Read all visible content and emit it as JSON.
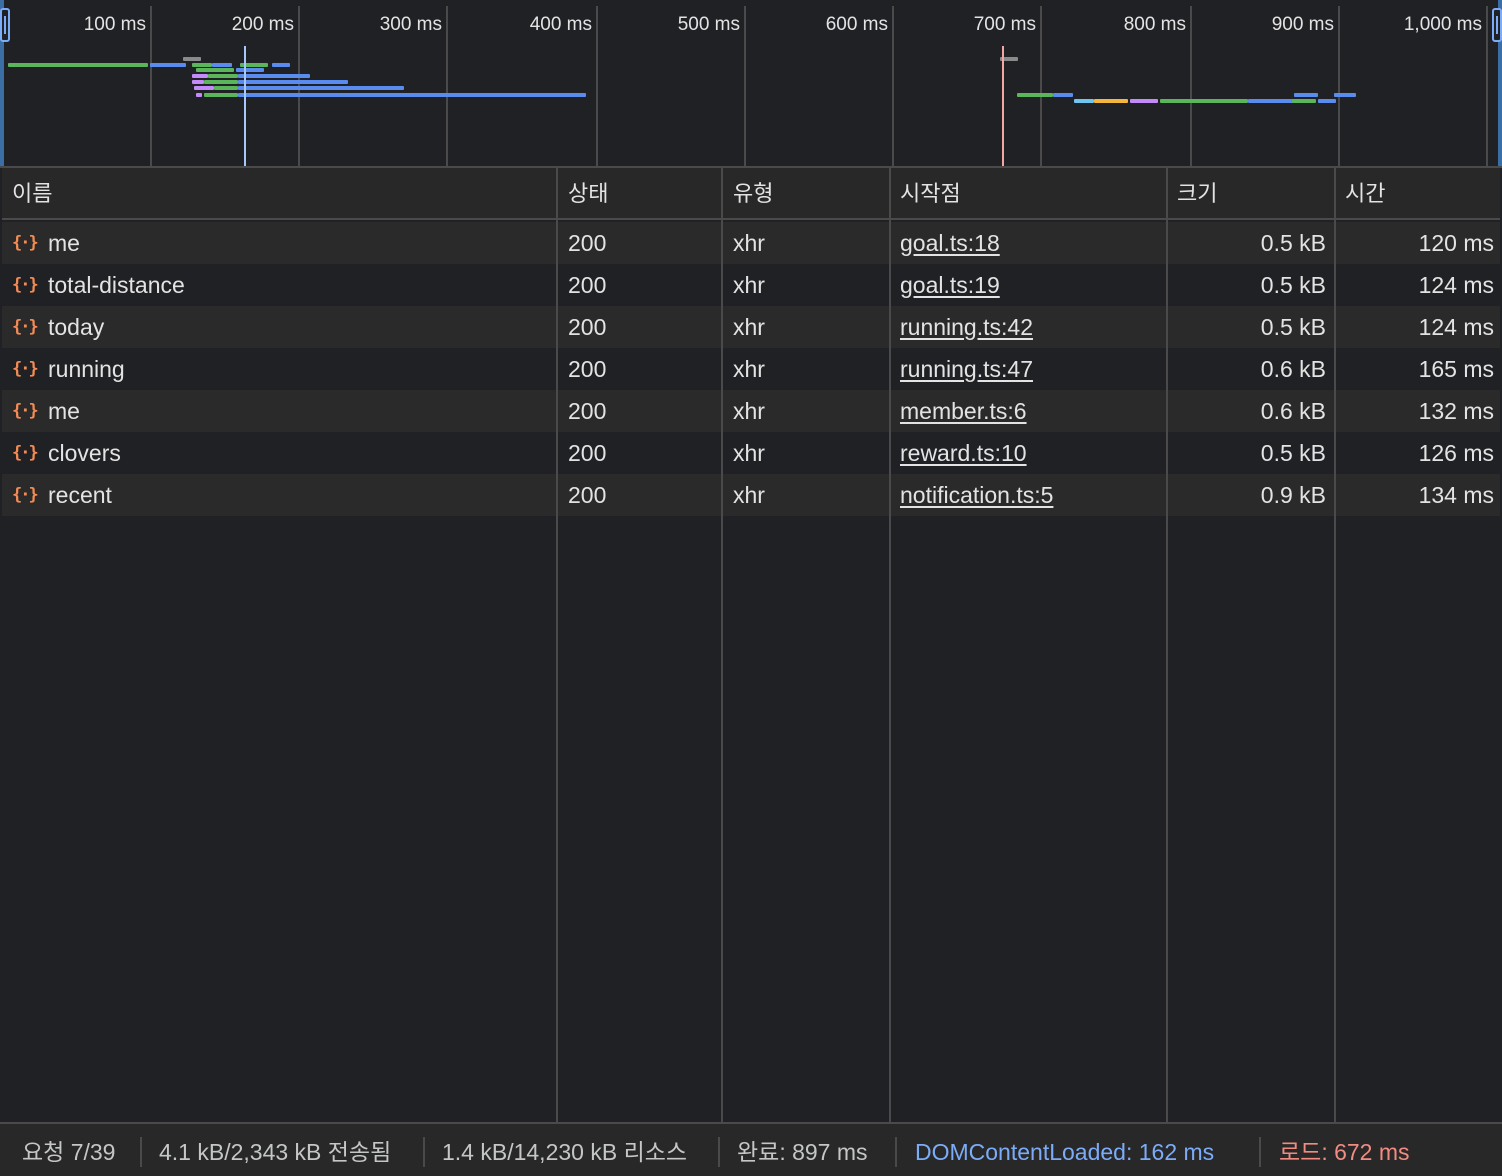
{
  "overview": {
    "ticks": [
      "100 ms",
      "200 ms",
      "300 ms",
      "400 ms",
      "500 ms",
      "600 ms",
      "700 ms",
      "800 ms",
      "900 ms",
      "1,000 ms"
    ],
    "dom_content_loaded_color": "#a8c7fa",
    "load_color": "#f3a7a0"
  },
  "columns": {
    "name": "이름",
    "status": "상태",
    "type": "유형",
    "initiator": "시작점",
    "size": "크기",
    "time": "시간"
  },
  "requests": [
    {
      "icon": "xhr-fetch-icon",
      "name": "me",
      "status": "200",
      "type": "xhr",
      "initiator": "goal.ts:18",
      "size": "0.5 kB",
      "time": "120 ms"
    },
    {
      "icon": "xhr-fetch-icon",
      "name": "total-distance",
      "status": "200",
      "type": "xhr",
      "initiator": "goal.ts:19",
      "size": "0.5 kB",
      "time": "124 ms"
    },
    {
      "icon": "xhr-fetch-icon",
      "name": "today",
      "status": "200",
      "type": "xhr",
      "initiator": "running.ts:42",
      "size": "0.5 kB",
      "time": "124 ms"
    },
    {
      "icon": "xhr-fetch-icon",
      "name": "running",
      "status": "200",
      "type": "xhr",
      "initiator": "running.ts:47",
      "size": "0.6 kB",
      "time": "165 ms"
    },
    {
      "icon": "xhr-fetch-icon",
      "name": "me",
      "status": "200",
      "type": "xhr",
      "initiator": "member.ts:6",
      "size": "0.6 kB",
      "time": "132 ms"
    },
    {
      "icon": "xhr-fetch-icon",
      "name": "clovers",
      "status": "200",
      "type": "xhr",
      "initiator": "reward.ts:10",
      "size": "0.5 kB",
      "time": "126 ms"
    },
    {
      "icon": "xhr-fetch-icon",
      "name": "recent",
      "status": "200",
      "type": "xhr",
      "initiator": "notification.ts:5",
      "size": "0.9 kB",
      "time": "134 ms"
    }
  ],
  "status_bar": {
    "requests": "요청 7/39",
    "transferred": "4.1 kB/2,343 kB 전송됨",
    "resources": "1.4 kB/14,230 kB 리소스",
    "finish": "완료: 897 ms",
    "dom_content_loaded": "DOMContentLoaded: 162 ms",
    "load": "로드: 672 ms",
    "dom_content_loaded_color": "#7cacf8",
    "load_color": "#f28b82"
  },
  "colors": {
    "waiting_blue": "#5a8cf0",
    "download_green": "#5bb55b",
    "queue_purple": "#c58af9",
    "stalled_gray": "#8a8a8a",
    "dns_cyan": "#6ec5f0",
    "connect_orange": "#f5b63c"
  }
}
